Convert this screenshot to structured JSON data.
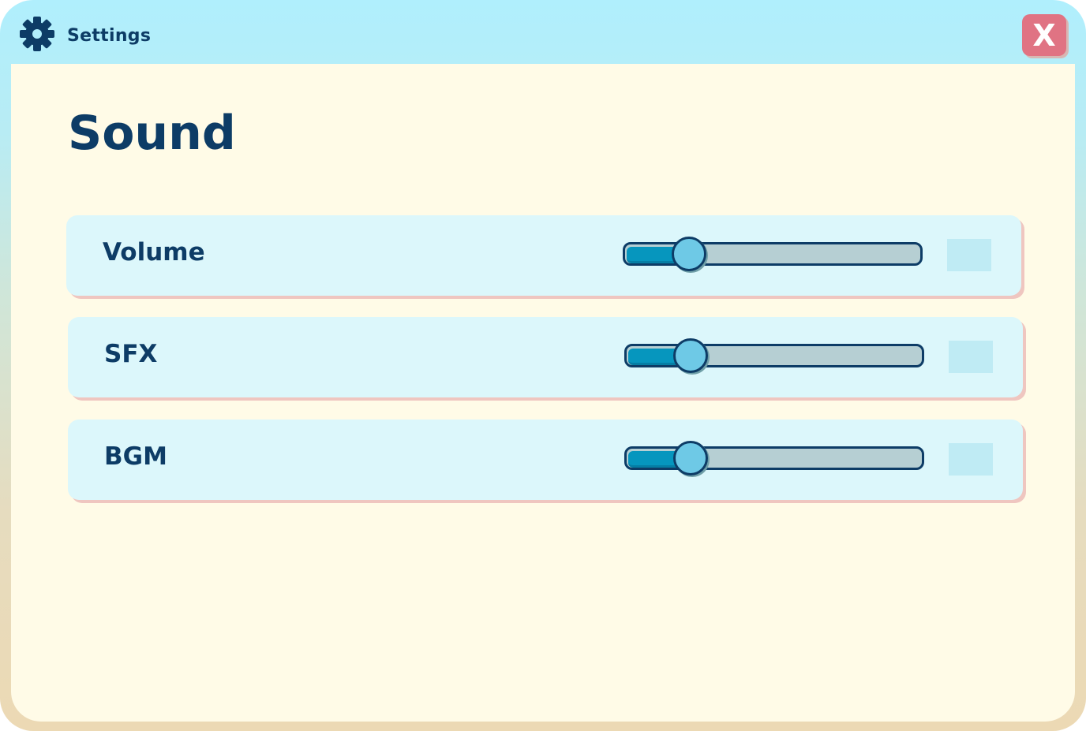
{
  "window": {
    "title": "Settings",
    "close_label": "X"
  },
  "section": {
    "heading": "Sound"
  },
  "sliders": [
    {
      "label": "Volume",
      "level": 0.17,
      "value_text": ""
    },
    {
      "label": "SFX",
      "level": 0.17,
      "value_text": ""
    },
    {
      "label": "BGM",
      "level": 0.17,
      "value_text": ""
    }
  ],
  "icons": {
    "title": "gear-icon",
    "close": "close-icon"
  },
  "colors": {
    "titlebar": "#b0effd",
    "panel": "#fffbe7",
    "row": "#dcf7fb",
    "row_shadow": "#efc6c0",
    "text": "#0d3c66",
    "close_button": "#e07383",
    "slider_fill": "#0696be",
    "slider_track": "#b6cfd3",
    "slider_knob": "#6ec9e6"
  }
}
